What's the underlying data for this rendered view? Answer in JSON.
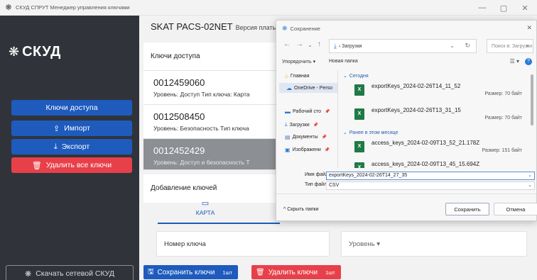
{
  "window": {
    "title": "СКУД СПРУТ Менеджер управления ключами",
    "minimize": "—",
    "maximize": "▢",
    "close": "✕"
  },
  "sidebar": {
    "logo_text": "СКУД",
    "keys_button": "Ключи доступа",
    "import_button": "Импорт",
    "export_button": "Экспорт",
    "delete_all_button": "Удалить все ключи",
    "download_button": "Скачать сетевой СКУД"
  },
  "main": {
    "device_title": "SKAT PACS-02NET",
    "version_label": "Версия платы:",
    "keys_header": "Ключи доступа",
    "keys": [
      {
        "number": "0012459060",
        "meta": "Уровень: Доступ  Тип ключа: Карта"
      },
      {
        "number": "0012508450",
        "meta": "Уровень: Безопасность  Тип ключа"
      },
      {
        "number": "0012452429",
        "meta": "Уровень: Доступ и безопасность  Т"
      }
    ],
    "add_header": "Добавление ключей",
    "tab_card": "КАРТА",
    "key_number_field": "Номер ключа",
    "level_field": "Уровень ▾",
    "save_keys_button": "Сохранить ключи",
    "save_keys_count": "1шт",
    "delete_keys_button": "Удалить ключи",
    "delete_keys_count": "1шт"
  },
  "dialog": {
    "title": "Сохранение",
    "address": "› Загрузки",
    "search_placeholder": "Поиск в: Загрузки",
    "organize": "Упорядочить ▾",
    "new_folder": "Новая папка",
    "nav_items": [
      {
        "label": "Главная",
        "icon": "home-icon"
      },
      {
        "label": "OneDrive - Perso",
        "icon": "cloud-icon"
      },
      {
        "label": "Рабочий сто",
        "icon": "desktop-icon"
      },
      {
        "label": "Загрузки",
        "icon": "download-icon"
      },
      {
        "label": "Документы",
        "icon": "document-icon"
      },
      {
        "label": "Изображени",
        "icon": "image-icon"
      }
    ],
    "group_today": "Сегодня",
    "group_earlier": "Ранее в этом месяце",
    "files": [
      {
        "name": "exportKeys_2024-02-26T14_11_52",
        "size": "Размер: 70 байт"
      },
      {
        "name": "exportKeys_2024-02-26T13_31_15",
        "size": "Размер: 70 байт"
      },
      {
        "name": "access_keys_2024-02-09T13_52_21.178Z",
        "size": "Размер: 151 байт"
      },
      {
        "name": "access_keys_2024-02-09T13_45_15.694Z",
        "size": ""
      }
    ],
    "file_name_label": "Имя файла:",
    "file_name_value": "exportKeys_2024-02-26T14_27_35",
    "file_type_label": "Тип файла:",
    "file_type_value": "CSV",
    "hide_folders": "^ Скрыть папки",
    "save_button": "Сохранить",
    "cancel_button": "Отмена"
  },
  "colors": {
    "primary": "#1e5bbd",
    "danger": "#e8404a",
    "sidebar_bg": "#30343a",
    "selected_row": "#8c8f93"
  }
}
